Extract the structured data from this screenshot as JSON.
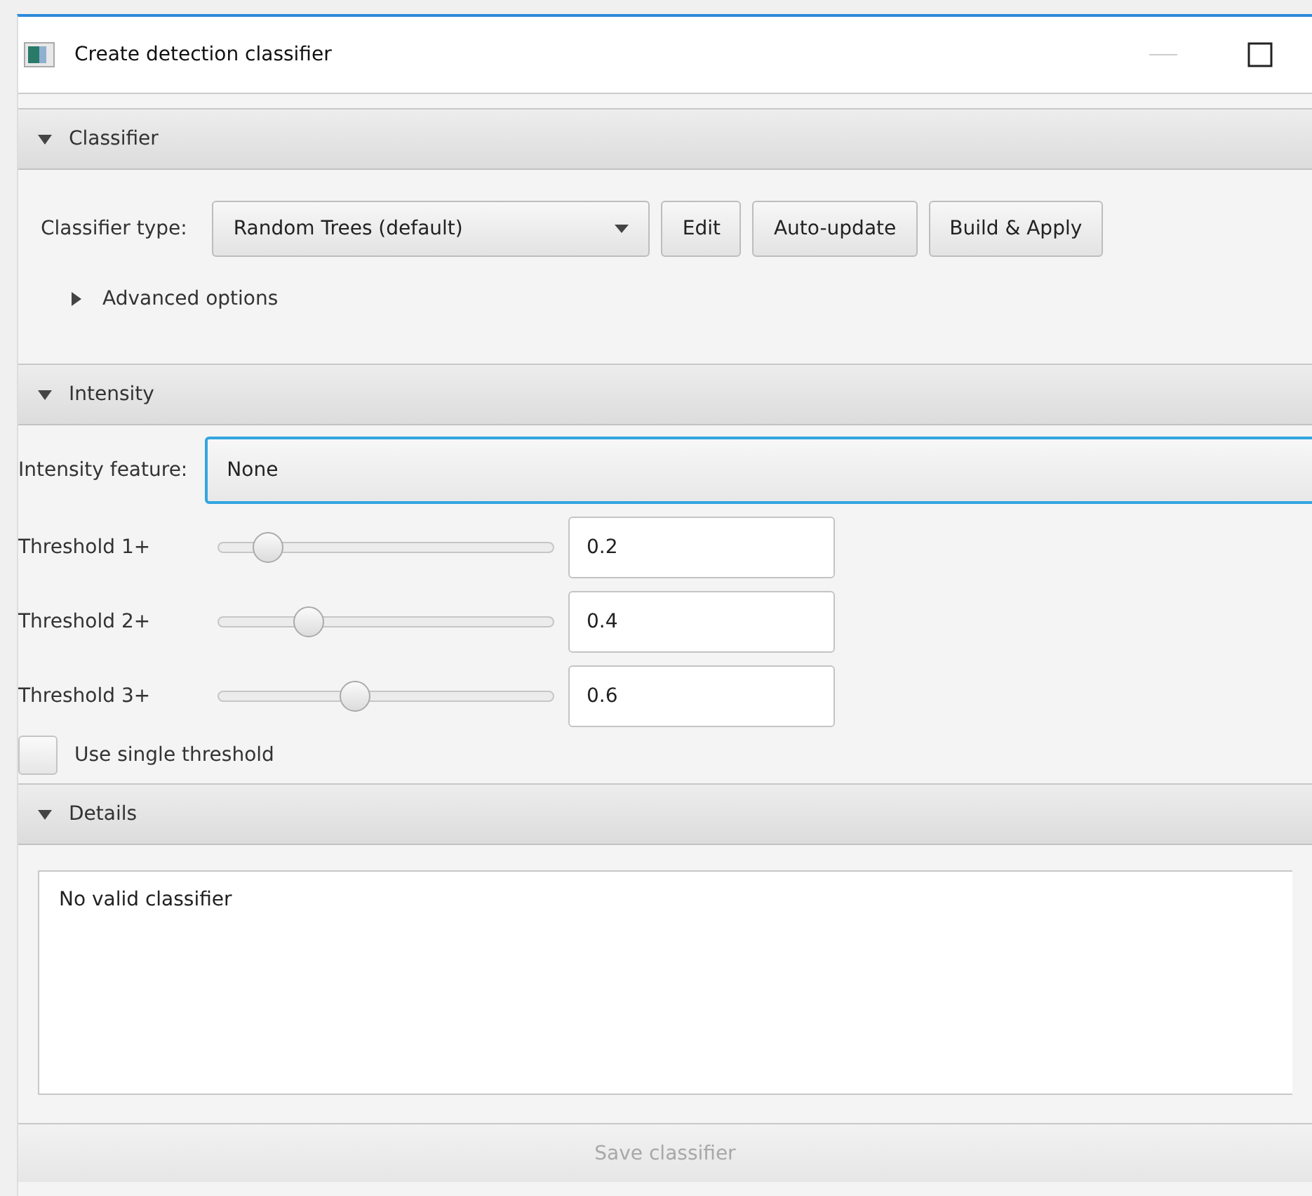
{
  "window": {
    "title": "Create detection classifier"
  },
  "classifier_section": {
    "title": "Classifier",
    "expanded": true,
    "classifier_type_label": "Classifier type:",
    "classifier_type": "Random Trees (default)",
    "buttons": [
      "Edit",
      "Auto-update",
      "Build & Apply"
    ],
    "advanced_options": {
      "label": "Advanced options",
      "expanded": false
    }
  },
  "intensity_section": {
    "title": "Intensity",
    "expanded": true,
    "feature_label": "Intensity feature:",
    "feature": "None",
    "thresholds": [
      {
        "label": "Threshold 1+",
        "level": 0.15,
        "value": "0.2"
      },
      {
        "label": "Threshold 2+",
        "level": 0.27,
        "value": "0.4"
      },
      {
        "label": "Threshold 3+",
        "level": 0.41,
        "value": "0.6"
      }
    ],
    "single_threshold": {
      "label": "Use single threshold",
      "checked": false
    }
  },
  "details_section": {
    "title": "Details",
    "expanded": true,
    "text": "No valid classifier"
  },
  "save_button": {
    "label": "Save classifier",
    "disabled": true
  }
}
